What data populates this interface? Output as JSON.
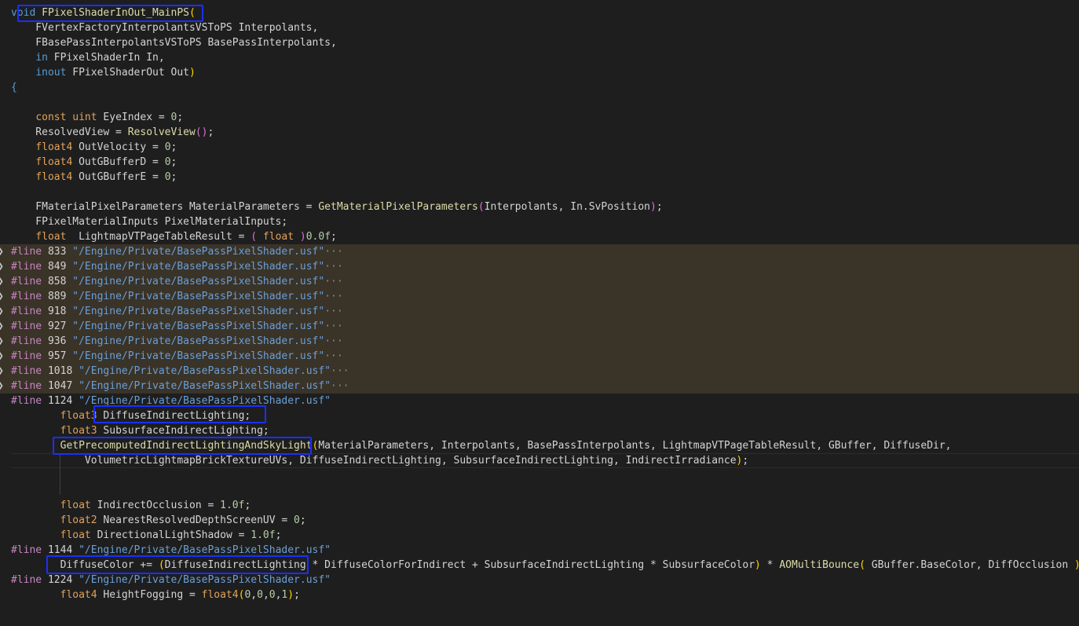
{
  "lines": [
    [
      "void ",
      "FPixelShaderInOut_MainPS",
      "("
    ],
    [
      "    FVertexFactoryInterpolantsVSToPS Interpolants,"
    ],
    [
      "    FBasePassInterpolantsVSToPS BasePassInterpolants,"
    ],
    [
      "    ",
      "in",
      " FPixelShaderIn In,"
    ],
    [
      "    ",
      "inout",
      " FPixelShaderOut Out",
      ")"
    ],
    [
      "{"
    ],
    [
      ""
    ],
    [
      "    ",
      "const",
      " ",
      "uint",
      " EyeIndex = ",
      "0",
      ";"
    ],
    [
      "    ResolvedView = ",
      "ResolveView",
      "()",
      ";"
    ],
    [
      "    ",
      "float4",
      " OutVelocity = ",
      "0",
      ";"
    ],
    [
      "    ",
      "float4",
      " OutGBufferD = ",
      "0",
      ";"
    ],
    [
      "    ",
      "float4",
      " OutGBufferE = ",
      "0",
      ";"
    ],
    [
      ""
    ],
    [
      "    FMaterialPixelParameters MaterialParameters = ",
      "GetMaterialPixelParameters",
      "(",
      "Interpolants, In.SvPosition",
      ")",
      ";"
    ],
    [
      "    FPixelMaterialInputs PixelMaterialInputs;"
    ],
    [
      "    ",
      "float",
      "  LightmapVTPageTableResult = ",
      "( ",
      "float",
      " )",
      "0.0f",
      ";"
    ],
    [
      "#line",
      " 833 ",
      "\"/Engine/Private/BasePassPixelShader.usf\"",
      "···"
    ],
    [
      "#line",
      " 849 ",
      "\"/Engine/Private/BasePassPixelShader.usf\"",
      "···"
    ],
    [
      "#line",
      " 858 ",
      "\"/Engine/Private/BasePassPixelShader.usf\"",
      "···"
    ],
    [
      "#line",
      " 889 ",
      "\"/Engine/Private/BasePassPixelShader.usf\"",
      "···"
    ],
    [
      "#line",
      " 918 ",
      "\"/Engine/Private/BasePassPixelShader.usf\"",
      "···"
    ],
    [
      "#line",
      " 927 ",
      "\"/Engine/Private/BasePassPixelShader.usf\"",
      "···"
    ],
    [
      "#line",
      " 936 ",
      "\"/Engine/Private/BasePassPixelShader.usf\"",
      "···"
    ],
    [
      "#line",
      " 957 ",
      "\"/Engine/Private/BasePassPixelShader.usf\"",
      "···"
    ],
    [
      "#line",
      " 1018 ",
      "\"/Engine/Private/BasePassPixelShader.usf\"",
      "···"
    ],
    [
      "#line",
      " 1047 ",
      "\"/Engine/Private/BasePassPixelShader.usf\"",
      "···"
    ],
    [
      "#line",
      " 1124 ",
      "\"/Engine/Private/BasePassPixelShader.usf\""
    ],
    [
      "        ",
      "float3",
      " DiffuseIndirectLighting;"
    ],
    [
      "        ",
      "float3",
      " SubsurfaceIndirectLighting;"
    ],
    [
      "        ",
      "GetPrecomputedIndirectLightingAndSkyLight",
      "(",
      "MaterialParameters, Interpolants, BasePassInterpolants, LightmapVTPageTableResult, GBuffer, DiffuseDir,"
    ],
    [
      "            VolumetricLightmapBrickTextureUVs, DiffuseIndirectLighting, SubsurfaceIndirectLighting, IndirectIrradiance",
      ")",
      ";"
    ],
    [
      ""
    ],
    [
      ""
    ],
    [
      "        ",
      "float",
      " IndirectOcclusion = ",
      "1.0f",
      ";"
    ],
    [
      "        ",
      "float2",
      " NearestResolvedDepthScreenUV = ",
      "0",
      ";"
    ],
    [
      "        ",
      "float",
      " DirectionalLightShadow = ",
      "1.0f",
      ";"
    ],
    [
      "#line",
      " 1144 ",
      "\"/Engine/Private/BasePassPixelShader.usf\""
    ],
    [
      "        DiffuseColor += ",
      "(",
      "DiffuseIndirectLighting * DiffuseColorForIndirect + SubsurfaceIndirectLighting * SubsurfaceColor",
      ")",
      " * ",
      "AOMultiBounce",
      "(",
      " GBuffer.BaseColor, DiffOcclusion ",
      ")",
      ";"
    ],
    [
      "#line",
      " 1224 ",
      "\"/Engine/Private/BasePassPixelShader.usf\""
    ],
    [
      "        ",
      "float4",
      " HeightFogging = ",
      "float4",
      "(",
      "0",
      ",",
      "0",
      ",",
      "0",
      ",",
      "1",
      ")",
      ";"
    ],
    [
      ""
    ]
  ],
  "colors": {
    "background": "#1e1e1e",
    "folded_region": "#3a3328",
    "highlight_box": "#1a2fff"
  },
  "icons": {
    "fold": "chevron-right-icon"
  }
}
